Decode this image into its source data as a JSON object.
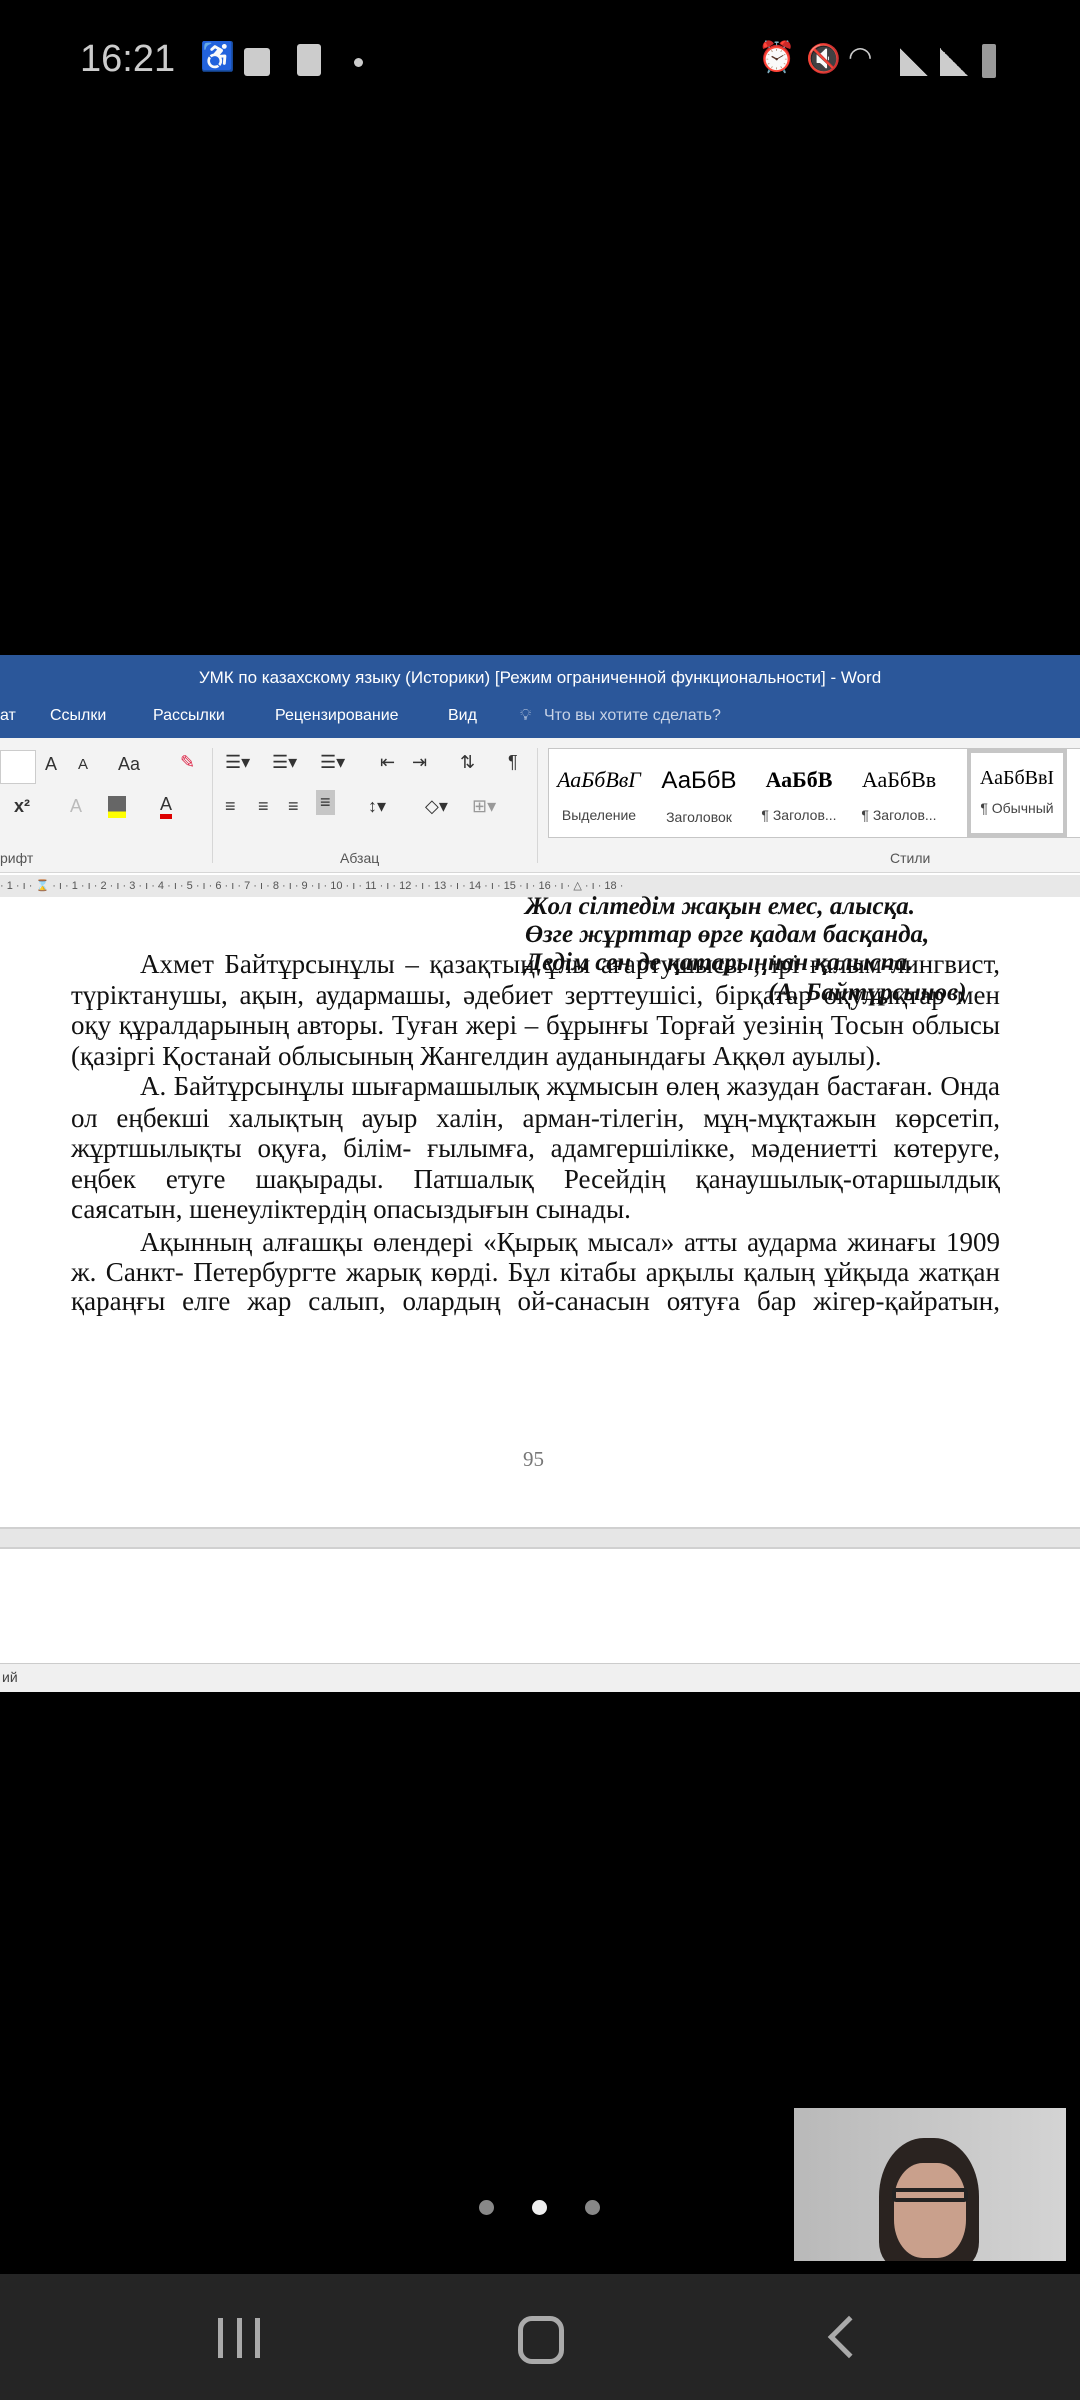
{
  "status_bar": {
    "time": "16:21",
    "left_icons": [
      "accessibility-icon",
      "folder-icon",
      "screen-record-icon",
      "dot-icon"
    ],
    "right_icons": [
      "alarm-icon",
      "mute-icon",
      "wifi-icon",
      "signal-icon",
      "signal-icon",
      "battery-charging-icon"
    ]
  },
  "word": {
    "title": "УМК по казахскому языку (Историки) [Режим ограниченной функциональности] - Word",
    "tabs": [
      "ат",
      "Ссылки",
      "Рассылки",
      "Рецензирование",
      "Вид"
    ],
    "tell_me": "Что вы хотите сделать?",
    "groups": {
      "font": "рифт",
      "paragraph": "Абзац",
      "styles": "Стили"
    },
    "font_buttons": {
      "grow": "A",
      "shrink": "A",
      "case": "Aa",
      "superscript": "x²"
    },
    "pilcrow": "¶",
    "styles": [
      {
        "sample": "АаБбВвГ",
        "label": "Выделение"
      },
      {
        "sample": "АаБбВ",
        "label": "Заголовок"
      },
      {
        "sample": "АаБбВ",
        "label": "¶ Заголов..."
      },
      {
        "sample": "АаБбВв",
        "label": "¶ Заголов..."
      },
      {
        "sample": "АаБбВвI",
        "label": "¶ Обычный"
      }
    ],
    "ruler": "· 1 · ı · ⌛ · ı · 1 · ı · 2 · ı · 3 · ı · 4 · ı · 5 · ı · 6 · ı · 7 · ı · 8 · ı · 9 · ı · 10 · ı · 11 · ı · 12 · ı · 13 · ı · 14 · ı · 15 · ı · 16 · ı · △ · ı · 18 ·",
    "poem": [
      "Жол сілтедім жақын емес, алысқа.",
      "Өзге жұрттар өрге қадам басқанда,",
      "Дедім сен де қатарыңнан қалыспа.",
      "(А. Байтұрсынов)"
    ],
    "paragraphs": [
      [
        "Ахмет Байтұрсынұлы – қазақтың ұлы ағартушысы , ірі ғалым-лингвист,",
        "түріктанушы, ақын, аудармашы, әдебиет зерттеушісі, бірқатар оқулықтар мен",
        "оқу құралдарының авторы. Туған жері – бұрынғы Торғай уезінің Тосын облысы",
        "(қазіргі Қостанай облысының Жангелдин ауданындағы Аққөл ауылы)."
      ],
      [
        "А. Байтұрсынұлы шығармашылық жұмысын өлең жазудан бастаған. Онда",
        "ол еңбекші халықтың ауыр халін, арман-тілегін, мұң-мұқтажын көрсетіп,",
        "жұртшылықты оқуға, білім- ғылымға, адамгершілікке, мәдениетті көтеруге,",
        "еңбек етуге шақырады. Патшалық Ресейдің қанаушылық-отаршылдық",
        "саясатын, шенеуліктердің опасыздығын сынады."
      ],
      [
        "Ақынның алғашқы өлендері «Қырық мысал» атты аударма жинағы 1909",
        "ж. Санкт- Петербургте жарық көрді. Бұл кітабы арқылы қалың ұйқыда жатқан",
        "қараңғы елге жар салып, олардың ой-санасын оятуға бар жігер-қайратын,"
      ]
    ],
    "page_number": "95",
    "status_text": "ий"
  },
  "colors": {
    "word_blue": "#2b579a"
  }
}
